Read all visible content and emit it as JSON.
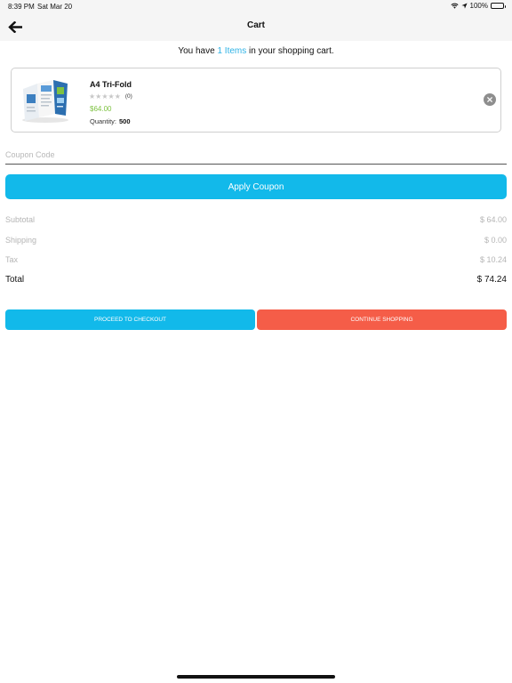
{
  "status_bar": {
    "time": "8:39 PM",
    "date": "Sat Mar 20",
    "battery": "100%"
  },
  "nav": {
    "title": "Cart",
    "back_icon": "arrow-left-icon"
  },
  "cart_summary": {
    "prefix": "You have ",
    "count": "1 Items",
    "suffix": " in your shopping cart."
  },
  "item": {
    "name": "A4 Tri-Fold",
    "rating_count": "(0)",
    "rating": 0,
    "price": "$64.00",
    "quantity_label": "Quantity:",
    "quantity": "500"
  },
  "coupon": {
    "placeholder": "Coupon Code",
    "value": "",
    "apply_label": "Apply Coupon"
  },
  "totals": {
    "subtotal_label": "Subtotal",
    "subtotal": "$ 64.00",
    "shipping_label": "Shipping",
    "shipping": "$ 0.00",
    "tax_label": "Tax",
    "tax": "$ 10.24",
    "total_label": "Total",
    "total": "$ 74.24"
  },
  "actions": {
    "checkout_label": "PROCEED TO CHECKOUT",
    "continue_label": "CONTINUE SHOPPING"
  },
  "colors": {
    "accent": "#12b9ea",
    "danger": "#f55d48",
    "price": "#7ec242",
    "link": "#2fb3e6"
  }
}
